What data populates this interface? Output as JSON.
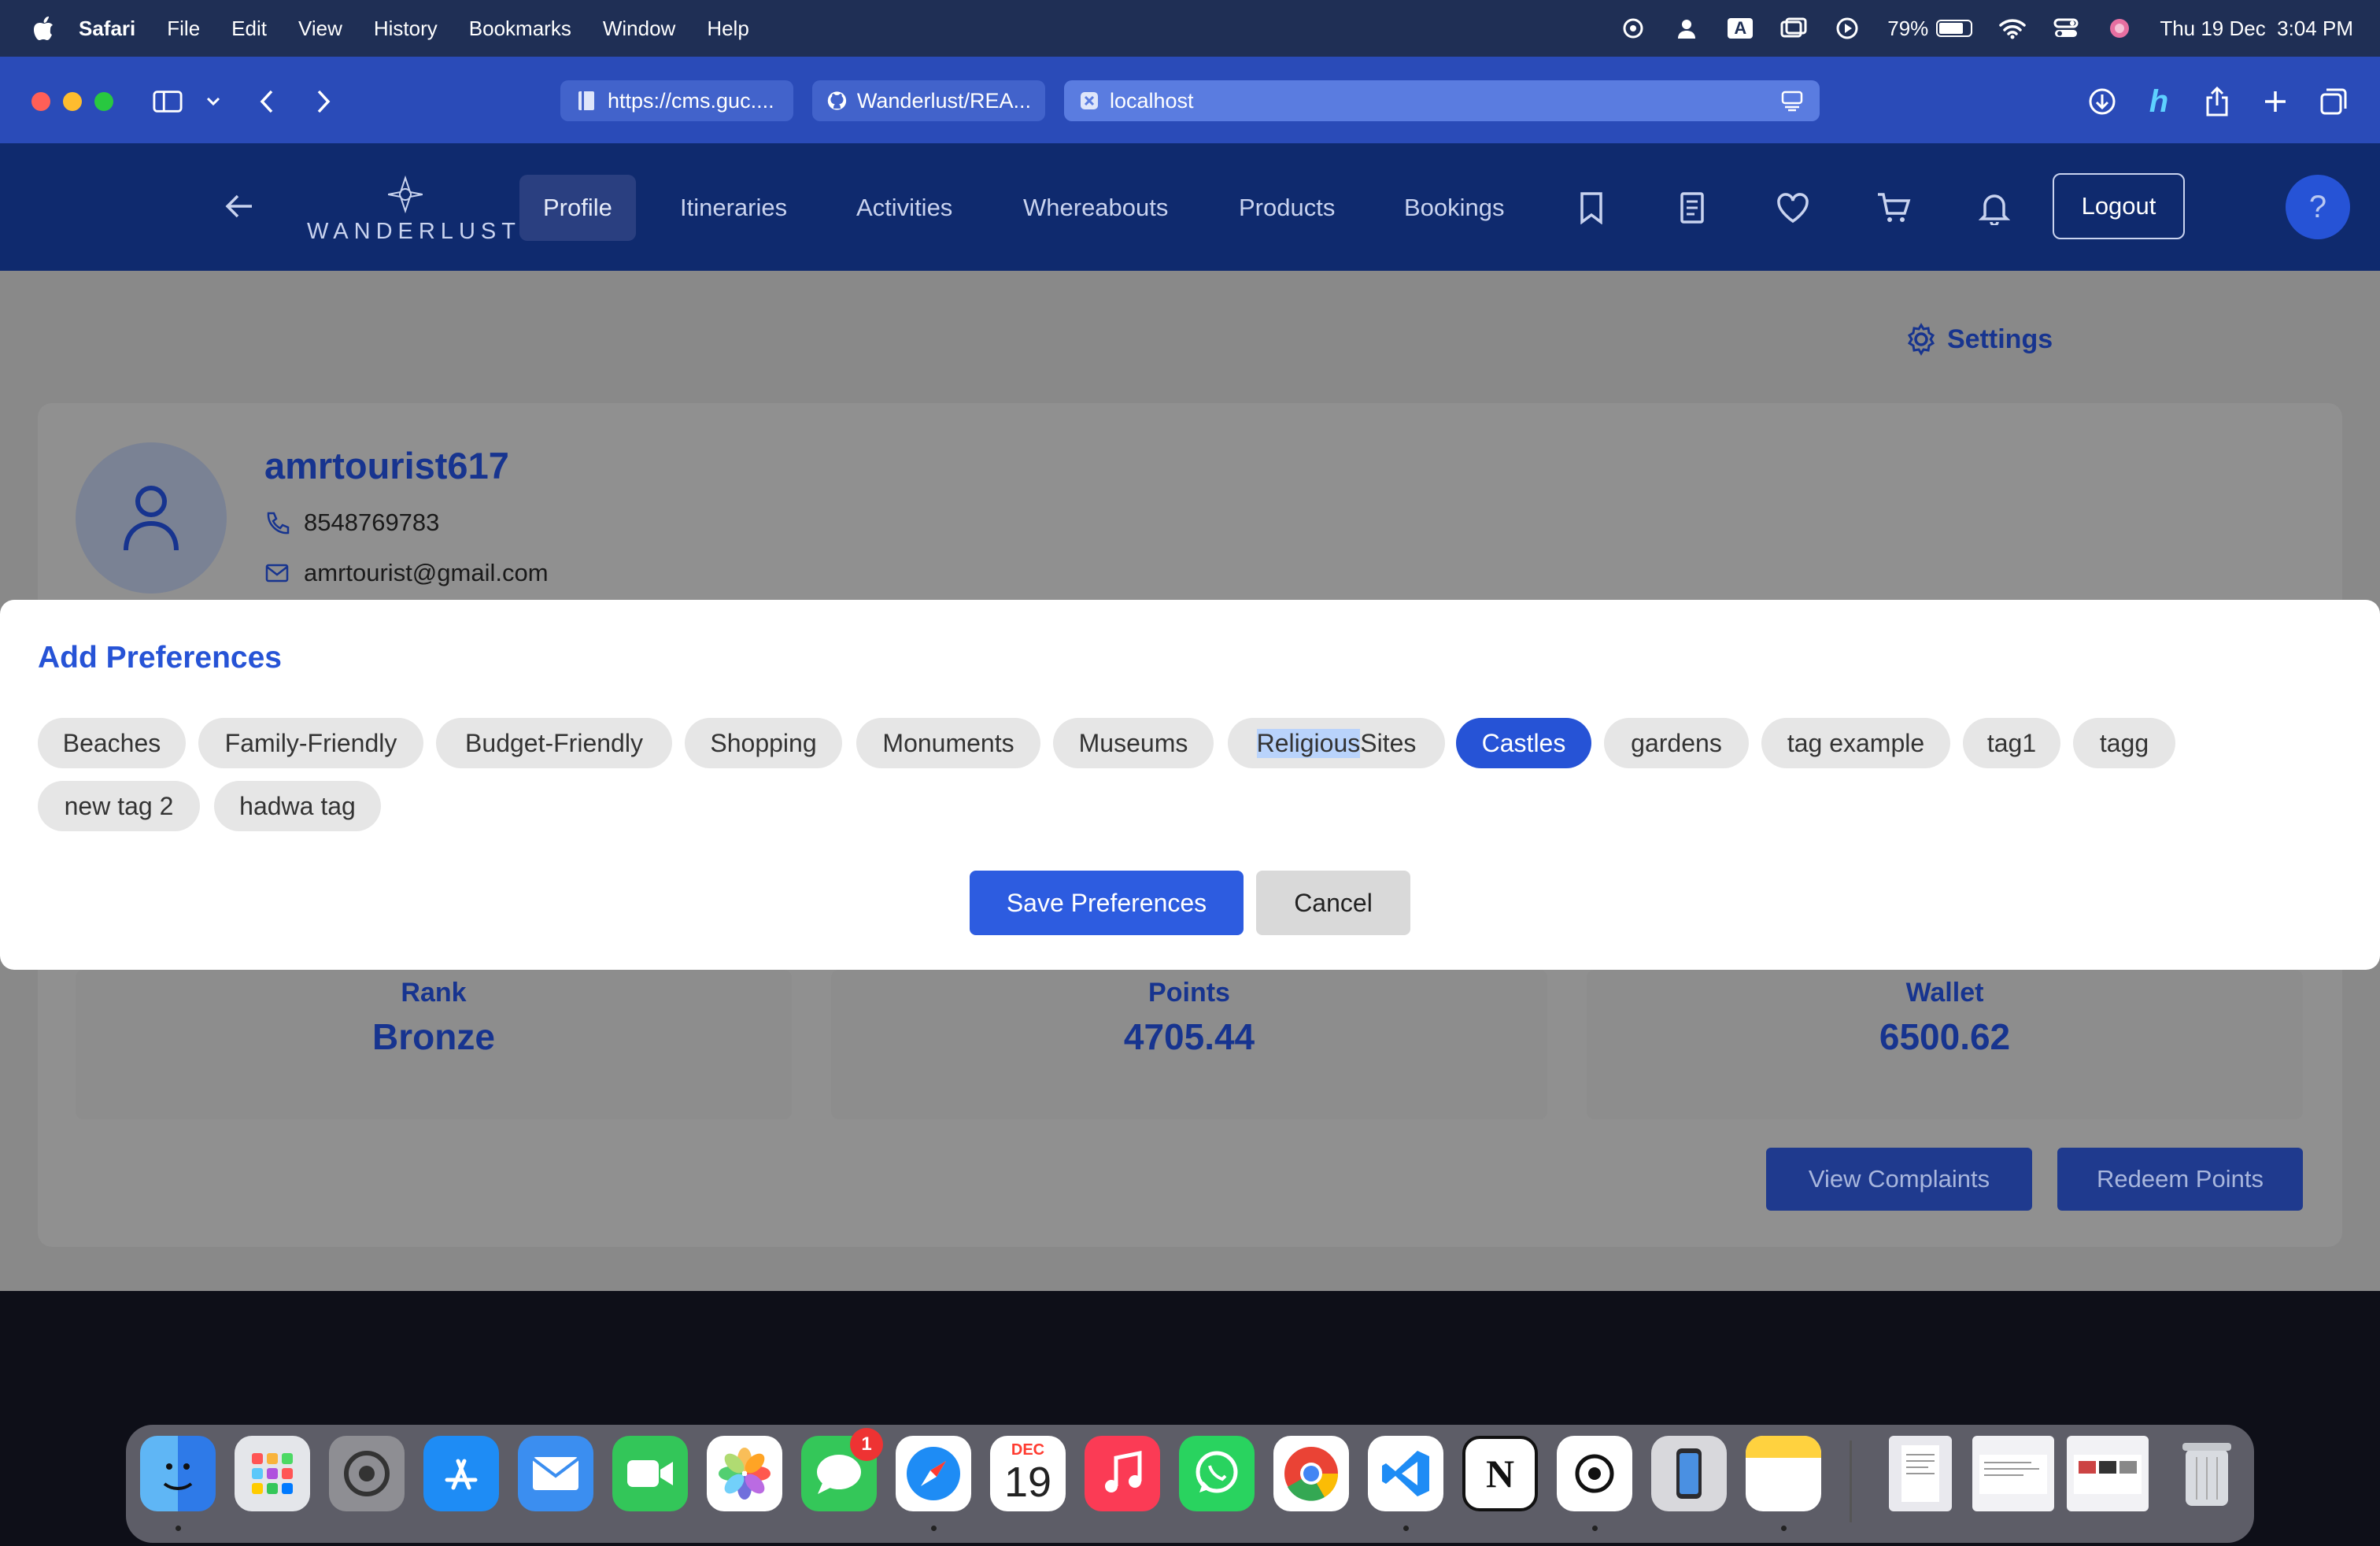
{
  "menubar": {
    "app": "Safari",
    "items": [
      "File",
      "Edit",
      "View",
      "History",
      "Bookmarks",
      "Window",
      "Help"
    ],
    "battery": "79%",
    "datetime": "Thu 19 Dec  3:04 PM",
    "input_indicator": "A"
  },
  "browser": {
    "tabs": [
      {
        "label": "https://cms.guc...."
      },
      {
        "label": "Wanderlust/REA..."
      },
      {
        "label": "localhost"
      }
    ]
  },
  "nav": {
    "logo": "WANDERLUST",
    "links": [
      "Profile",
      "Itineraries",
      "Activities",
      "Whereabouts",
      "Products",
      "Bookings"
    ],
    "active": "Profile",
    "logout": "Logout",
    "help": "?",
    "icons": [
      "bookmark-icon",
      "receipt-icon",
      "heart-icon",
      "cart-icon",
      "bell-icon"
    ]
  },
  "profile": {
    "settings": "Settings",
    "username": "amrtourist617",
    "phone": "8548769783",
    "email": "amrtourist@gmail.com",
    "stats": [
      {
        "label": "Rank",
        "value": "Bronze"
      },
      {
        "label": "Points",
        "value": "4705.44"
      },
      {
        "label": "Wallet",
        "value": "6500.62"
      }
    ],
    "view_complaints": "View Complaints",
    "redeem_points": "Redeem Points"
  },
  "modal": {
    "title": "Add Preferences",
    "tags": [
      {
        "label": "Beaches",
        "selected": false
      },
      {
        "label": "Family-Friendly",
        "selected": false
      },
      {
        "label": "Budget-Friendly",
        "selected": false
      },
      {
        "label": "Shopping",
        "selected": false
      },
      {
        "label": "Monuments",
        "selected": false
      },
      {
        "label": "Museums",
        "selected": false
      },
      {
        "label": "Religious Sites",
        "selected": false
      },
      {
        "label": "Castles",
        "selected": true
      },
      {
        "label": "gardens",
        "selected": false
      },
      {
        "label": "tag example",
        "selected": false
      },
      {
        "label": "tag1",
        "selected": false
      },
      {
        "label": "tagg",
        "selected": false
      },
      {
        "label": "new tag 2",
        "selected": false
      },
      {
        "label": "hadwa tag",
        "selected": false
      }
    ],
    "highlighted_text": "Religious",
    "save": "Save Preferences",
    "cancel": "Cancel"
  },
  "dock": {
    "calendar_month": "DEC",
    "calendar_day": "19",
    "messages_badge": "1",
    "notion_letter": "N",
    "apps": [
      "finder-icon",
      "launchpad-icon",
      "system-settings-icon",
      "app-store-icon",
      "mail-icon",
      "facetime-icon",
      "photos-icon",
      "messages-icon",
      "safari-icon",
      "calendar-icon",
      "music-icon",
      "whatsapp-icon",
      "chrome-icon",
      "vscode-icon",
      "notion-icon",
      "chatgpt-icon",
      "iphone-mirroring-icon",
      "notes-icon"
    ]
  }
}
